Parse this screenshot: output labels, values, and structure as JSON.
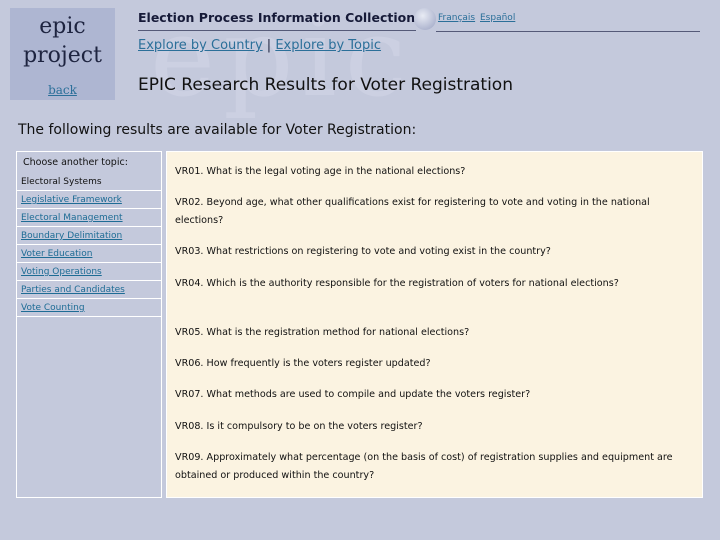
{
  "logo": {
    "line1": "epic",
    "line2": "project",
    "back": "back"
  },
  "watermark": "epic",
  "header": {
    "site_title": "Election Process Information Collection",
    "lang_fr": "Français",
    "lang_es": "Español"
  },
  "explore": {
    "by_country": "Explore by Country",
    "separator": "|",
    "by_topic": "Explore by Topic"
  },
  "page_title": "EPIC Research Results for Voter Registration",
  "subtitle": "The following results are available for Voter Registration:",
  "topics": {
    "label": "Choose another topic:",
    "items": [
      {
        "label": "Electoral Systems",
        "link": false
      },
      {
        "label": "Legislative Framework",
        "link": true
      },
      {
        "label": "Electoral Management",
        "link": true
      },
      {
        "label": "Boundary Delimitation",
        "link": true
      },
      {
        "label": "Voter Education",
        "link": true
      },
      {
        "label": "Voting Operations",
        "link": true
      },
      {
        "label": "Parties and Candidates",
        "link": true
      },
      {
        "label": "Vote Counting",
        "link": true
      }
    ]
  },
  "questions": [
    "VR01. What is the legal voting age in the national elections?",
    "VR02. Beyond age, what other qualifications exist for registering to vote and voting in the national elections?",
    "VR03. What restrictions on registering to vote and voting exist in the country?",
    "VR04. Which is the authority responsible for the registration of voters for national elections?",
    "VR05. What is the registration method for national elections?",
    "VR06. How frequently is the voters register updated?",
    "VR07. What methods are used to compile and update the voters register?",
    "VR08. Is it compulsory to be on the voters register?",
    "VR09. Approximately what percentage (on the basis of cost) of registration supplies and equipment are obtained or produced within the country?"
  ]
}
